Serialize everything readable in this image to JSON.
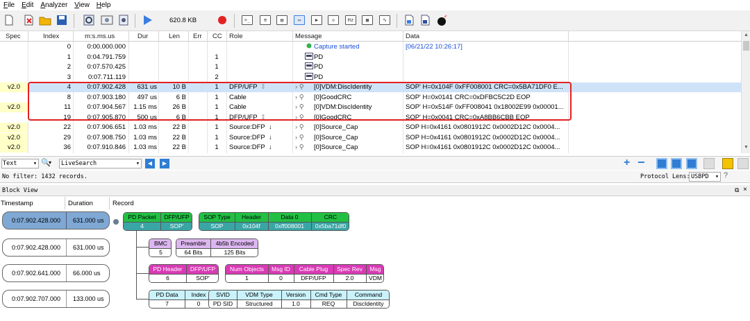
{
  "menu": [
    "File",
    "Edit",
    "Analyzer",
    "View",
    "Help"
  ],
  "toolbar": {
    "size": "620.8 KB",
    "icons": [
      "new-icon",
      "close-capture-icon",
      "open-icon",
      "save-icon",
      "settings-icon",
      "device-icon",
      "device2-icon",
      "play-icon",
      "record-icon",
      "view-icon",
      "view2-icon",
      "view3-icon",
      "view4-icon",
      "view5-icon",
      "hz-icon",
      "view6-icon",
      "chart-icon",
      "export-icon",
      "export2-icon",
      "bomb-icon"
    ]
  },
  "grid": {
    "columns": [
      "Spec",
      "Index",
      "m:s.ms.us",
      "Dur",
      "Len",
      "Err",
      "CC",
      "Role",
      "Message",
      "Data"
    ],
    "rows": [
      {
        "spec": "",
        "index": "0",
        "time": "0:00.000.000",
        "dur": "",
        "len": "",
        "err": "",
        "cc": "",
        "role": "",
        "message": "Capture started",
        "data": "[06/21/22 10:26:17]",
        "kind": "start"
      },
      {
        "spec": "",
        "index": "1",
        "time": "0:04.791.759",
        "dur": "",
        "len": "",
        "err": "",
        "cc": "1",
        "role": "",
        "message": "PD",
        "data": "",
        "kind": "pd"
      },
      {
        "spec": "",
        "index": "2",
        "time": "0:07.570.425",
        "dur": "",
        "len": "",
        "err": "",
        "cc": "1",
        "role": "",
        "message": "PD",
        "data": "",
        "kind": "pd"
      },
      {
        "spec": "",
        "index": "3",
        "time": "0:07.711.119",
        "dur": "",
        "len": "",
        "err": "",
        "cc": "2",
        "role": "",
        "message": "PD",
        "data": "",
        "kind": "pd"
      },
      {
        "spec": "v2.0",
        "index": "4",
        "time": "0:07.902.428",
        "dur": "631 us",
        "len": "10 B",
        "err": "",
        "cc": "1",
        "role": "DFP/UFP",
        "message": "[0]VDM:DiscIdentity",
        "data": "SOP' H=0x104F 0xFF008001 CRC=0x5BA71DF0 E...",
        "kind": "usb",
        "sel": true
      },
      {
        "spec": "",
        "index": "8",
        "time": "0:07.903.180",
        "dur": "497 us",
        "len": "6 B",
        "err": "",
        "cc": "1",
        "role": "Cable",
        "message": "[0]GoodCRC",
        "data": "SOP' H=0x0141 CRC=0xDFBC5C2D EOP",
        "kind": "usb"
      },
      {
        "spec": "v2.0",
        "index": "11",
        "time": "0:07.904.567",
        "dur": "1.15 ms",
        "len": "26 B",
        "err": "",
        "cc": "1",
        "role": "Cable",
        "message": "[0]VDM:DiscIdentity",
        "data": "SOP' H=0x514F 0xFF008041 0x18002E99 0x00001...",
        "kind": "usb"
      },
      {
        "spec": "",
        "index": "19",
        "time": "0:07.905.870",
        "dur": "500 us",
        "len": "6 B",
        "err": "",
        "cc": "1",
        "role": "DFP/UFP",
        "message": "[0]GoodCRC",
        "data": "SOP' H=0x0041 CRC=0xA8BB6CBB EOP",
        "kind": "usb"
      },
      {
        "spec": "v2.0",
        "index": "22",
        "time": "0:07.906.651",
        "dur": "1.03 ms",
        "len": "22 B",
        "err": "",
        "cc": "1",
        "role": "Source:DFP",
        "message": "[0]Source_Cap",
        "data": "SOP H=0x4161 0x0801912C 0x0002D12C 0x0004...",
        "kind": "usb"
      },
      {
        "spec": "v2.0",
        "index": "29",
        "time": "0:07.908.750",
        "dur": "1.03 ms",
        "len": "22 B",
        "err": "",
        "cc": "1",
        "role": "Source:DFP",
        "message": "[0]Source_Cap",
        "data": "SOP H=0x4161 0x0801912C 0x0002D12C 0x0004...",
        "kind": "usb"
      },
      {
        "spec": "v2.0",
        "index": "36",
        "time": "0:07.910.846",
        "dur": "1.03 ms",
        "len": "22 B",
        "err": "",
        "cc": "1",
        "role": "Source:DFP",
        "message": "[0]Source_Cap",
        "data": "SOP H=0x4161 0x0801912C 0x0002D12C 0x0004...",
        "kind": "usb"
      }
    ]
  },
  "filter": {
    "type": "Text",
    "search": "LiveSearch",
    "status": "No filter: 1432 records.",
    "lens_label": "Protocol Lens:",
    "lens_value": "USBPD"
  },
  "blockview": {
    "title": "Block View",
    "headers": [
      "Timestamp",
      "Duration",
      "Record"
    ],
    "times": [
      {
        "ts": "0:07.902.428.000",
        "dur": "631.000 us"
      },
      {
        "ts": "0:07.902.428.000",
        "dur": "631.000 us"
      },
      {
        "ts": "0:07.902.641.000",
        "dur": "66.000 us"
      },
      {
        "ts": "0:07.902.707.000",
        "dur": "133.000 us"
      }
    ],
    "pkt1": {
      "h": [
        "PD Packet",
        "DFP/UFP"
      ],
      "v": [
        "4",
        "SOP'"
      ]
    },
    "pkt2": {
      "h": [
        "SOP Type",
        "Header",
        "Data 0",
        "CRC"
      ],
      "v": [
        "SOP",
        "0x104f",
        "0xff008001",
        "0x5ba71df0"
      ]
    },
    "bmc": {
      "h": [
        "BMC"
      ],
      "v": [
        "5"
      ]
    },
    "pre": {
      "h": [
        "Preamble",
        "4b5b Encoded"
      ],
      "v": [
        "64 Bits",
        "125 Bits"
      ]
    },
    "pdh": {
      "h": [
        "PD Header",
        "DFP/UFP"
      ],
      "v": [
        "6",
        "SOP'"
      ]
    },
    "obj": {
      "h": [
        "Num Objects",
        "Msg ID",
        "Cable Plug",
        "Spec Rev",
        "Msg"
      ],
      "v": [
        "1",
        "0",
        "DFP/UFP",
        "2.0",
        "VDM"
      ]
    },
    "pdd": {
      "h": [
        "PD Data",
        "Index"
      ],
      "v": [
        "7",
        "0"
      ]
    },
    "svid": {
      "h": [
        "SVID",
        "VDM Type",
        "Version",
        "Cmd Type",
        "Command"
      ],
      "v": [
        "PD SID",
        "Structured",
        "1.0",
        "REQ",
        "DiscIdentity"
      ]
    }
  },
  "colors": {
    "highlight": "#e31f1f",
    "selected": "#cfe3f8",
    "spec": "#ffffc8"
  }
}
